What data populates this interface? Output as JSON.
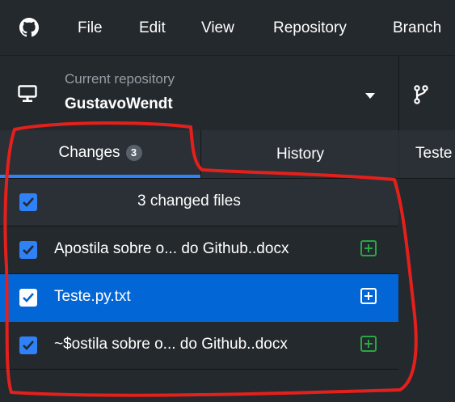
{
  "menu": {
    "items": [
      "File",
      "Edit",
      "View",
      "Repository",
      "Branch"
    ]
  },
  "repository": {
    "caption": "Current repository",
    "name": "GustavoWendt"
  },
  "tabs": {
    "changes_label": "Changes",
    "changes_count": "3",
    "history_label": "History"
  },
  "right_panel": {
    "title": "Teste"
  },
  "files": {
    "summary": "3 changed files",
    "items": [
      {
        "name": "Apostila sobre o... do Github..docx",
        "checked": true,
        "status": "added"
      },
      {
        "name": "Teste.py.txt",
        "checked": true,
        "status": "added",
        "selected": true
      },
      {
        "name": "~$ostila sobre o... do Github..docx",
        "checked": true,
        "status": "added"
      }
    ]
  },
  "colors": {
    "background": "#24292e",
    "accent": "#2f81f7",
    "selected_row": "#0366d6",
    "added": "#28a745",
    "annotation": "#e3201b"
  },
  "icons": {
    "app": "github-logo-icon",
    "repo": "monitor-icon",
    "dropdown": "caret-down-icon",
    "branch": "git-branch-icon",
    "file_status": "file-added-icon"
  }
}
